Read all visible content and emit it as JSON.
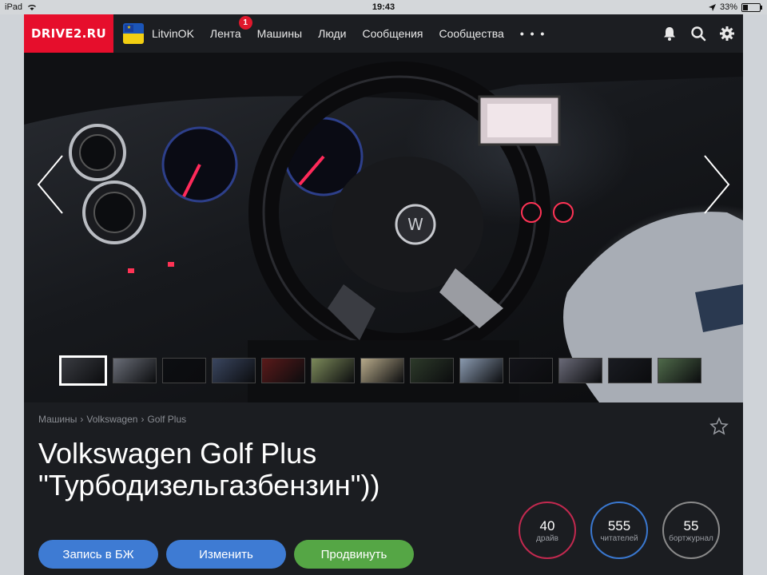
{
  "status_bar": {
    "device": "iPad",
    "time": "19:43",
    "battery": "33%",
    "battery_level": 0.33
  },
  "navbar": {
    "logo": "DRIVE2.RU",
    "username": "LitvinOK",
    "links": [
      {
        "label": "Лента",
        "badge": "1"
      },
      {
        "label": "Машины"
      },
      {
        "label": "Люди"
      },
      {
        "label": "Сообщения"
      },
      {
        "label": "Сообщества"
      }
    ],
    "more": "• • •",
    "icons": [
      "bell-icon",
      "search-icon",
      "gear-icon"
    ]
  },
  "gallery": {
    "thumbnail_count": 13,
    "active_index": 0,
    "thumb_colors": [
      "#3a3c42",
      "#6a6e78",
      "#0d0e12",
      "#3a4660",
      "#5a1a1a",
      "#7c8a5a",
      "#b7aa8a",
      "#2d3a2a",
      "#8a9ab0",
      "#14141a",
      "#6a6a78",
      "#1a1c22",
      "#4f6a4a"
    ]
  },
  "breadcrumb": [
    "Машины",
    "Volkswagen",
    "Golf Plus"
  ],
  "title_lines": [
    "Volkswagen Golf Plus",
    "\"Турбодизельгазбензин\"))"
  ],
  "buttons": {
    "journal": "Запись в БЖ",
    "edit": "Изменить",
    "promote": "Продвинуть"
  },
  "stats": [
    {
      "value": "40",
      "label": "драйв",
      "color": "#c2294f"
    },
    {
      "value": "555",
      "label": "читателей",
      "color": "#3a78d0"
    },
    {
      "value": "55",
      "label": "бортжурнал",
      "color": "#8a8a8a"
    }
  ],
  "colors": {
    "brand": "#e60e2c",
    "blue_button": "#3e7bd3",
    "green_button": "#55a645"
  }
}
